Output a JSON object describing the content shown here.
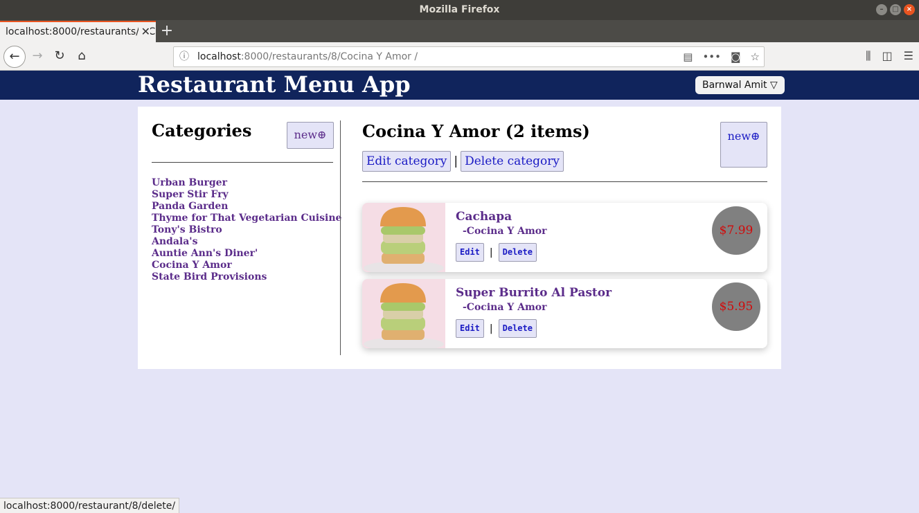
{
  "browser": {
    "window_title": "Mozilla Firefox",
    "tab_title": "localhost:8000/restaurants/8/Cocina Y Amor /",
    "url_host": "localhost",
    "url_rest": ":8000/restaurants/8/Cocina Y Amor /",
    "status_url": "localhost:8000/restaurant/8/delete/"
  },
  "header": {
    "app_title": "Restaurant Menu App",
    "user_label": "Barnwal Amit ▽"
  },
  "sidebar": {
    "title": "Categories",
    "new_label": "new⊕",
    "categories": [
      "Urban Burger",
      "Super Stir Fry",
      "Panda Garden",
      "Thyme for That Vegetarian Cuisine",
      "Tony's Bistro",
      "Andala's",
      "Auntie Ann's Diner'",
      "Cocina Y Amor",
      "State Bird Provisions"
    ]
  },
  "main": {
    "title": "Cocina Y Amor (2 items)",
    "new_label": "new⊕",
    "edit_label": "Edit category",
    "separator": "|",
    "delete_label": "Delete category",
    "items": [
      {
        "name": "Cachapa",
        "category": "-Cocina Y Amor",
        "price": "$7.99",
        "edit": "Edit",
        "delete": "Delete"
      },
      {
        "name": "Super Burrito Al Pastor",
        "category": "-Cocina Y Amor",
        "price": "$5.95",
        "edit": "Edit",
        "delete": "Delete"
      }
    ]
  },
  "colors": {
    "header_bg": "#10245c",
    "page_bg": "#e4e4f7",
    "link": "#5b2c8a",
    "price_text": "#d10a0a",
    "price_bg": "#808080"
  }
}
